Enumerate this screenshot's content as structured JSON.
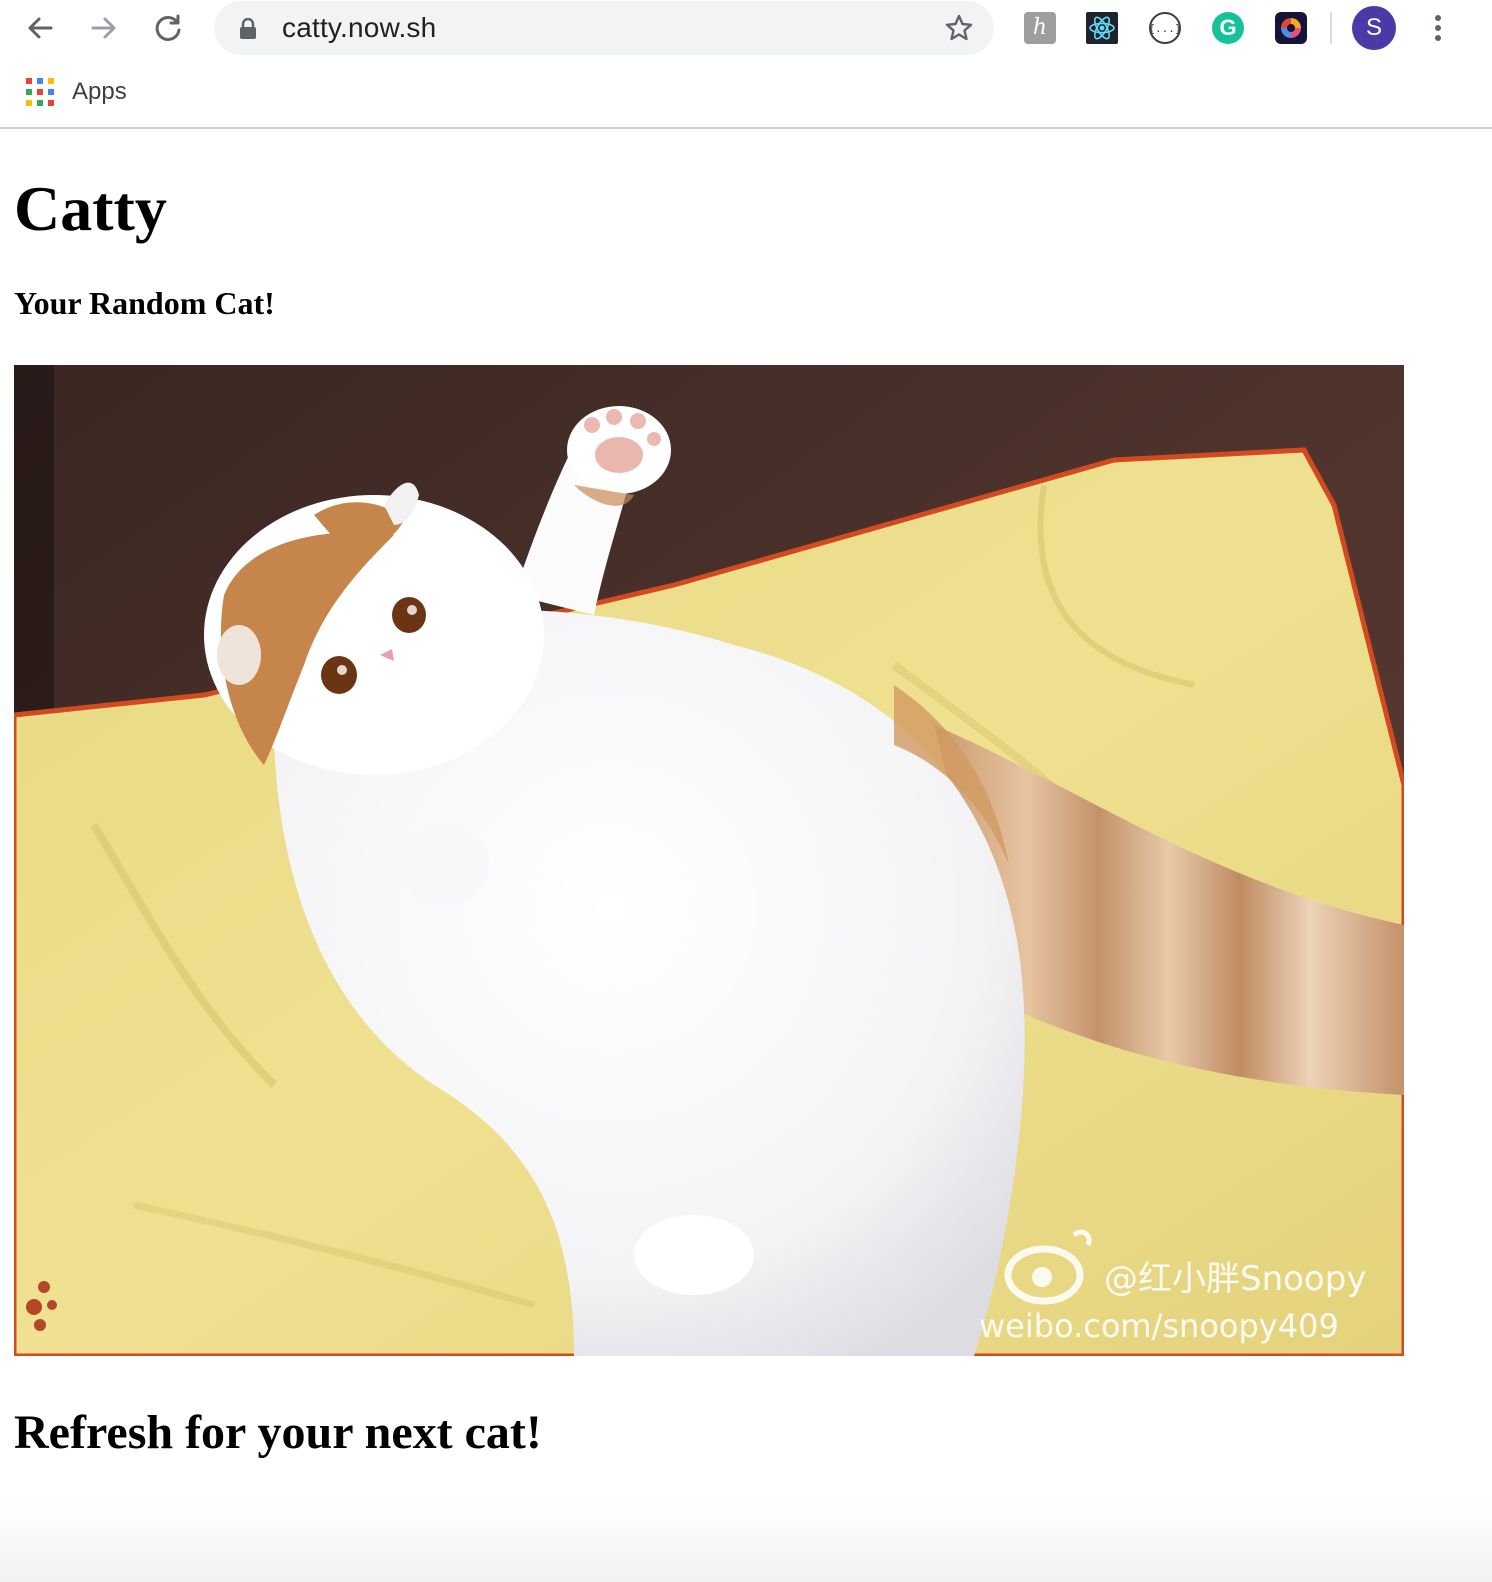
{
  "browser": {
    "url": "catty.now.sh",
    "bookmarks_bar": {
      "apps_label": "Apps"
    },
    "profile_initial": "S",
    "extensions": [
      "hypothesis-icon",
      "react-devtools-icon",
      "json-viewer-icon",
      "grammarly-icon",
      "color-picker-icon"
    ],
    "grammarly_letter": "G"
  },
  "page": {
    "title": "Catty",
    "subtitle": "Your Random Cat!",
    "footer": "Refresh for your next cat!",
    "image": {
      "watermark_line1": "@红小胖Snoopy",
      "watermark_line2": "weibo.com/snoopy409"
    }
  },
  "colors": {
    "accent_avatar": "#4a3aa8",
    "grammarly": "#15c39a",
    "blanket": "#ecdc86",
    "background_couch": "#4a2f2a",
    "blanket_trim": "#d24a1f"
  }
}
